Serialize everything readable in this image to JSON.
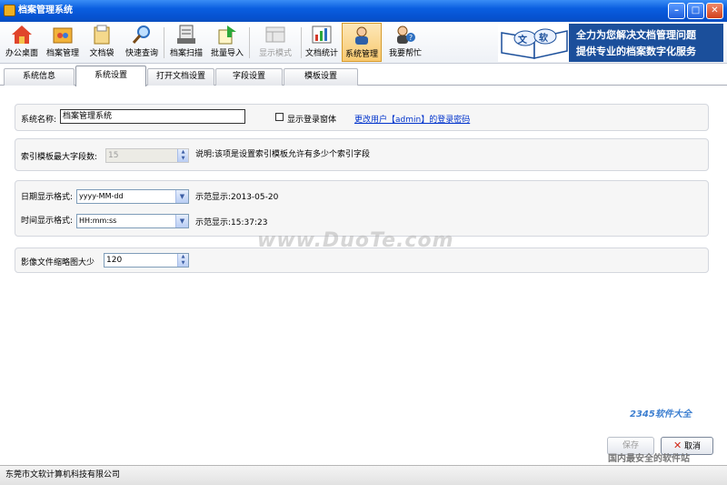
{
  "window": {
    "title": "档案管理系统",
    "minimize_icon": "minimize-icon",
    "maximize_icon": "maximize-icon",
    "close_icon": "close-icon"
  },
  "toolbar": {
    "items": [
      {
        "label": "办公桌面",
        "icon": "home-icon"
      },
      {
        "label": "档案管理",
        "icon": "folder-icon"
      },
      {
        "label": "文档袋",
        "icon": "envelope-icon"
      },
      {
        "label": "快速查询",
        "icon": "magnifier-icon"
      },
      {
        "label": "档案扫描",
        "icon": "scanner-icon"
      },
      {
        "label": "批量导入",
        "icon": "import-icon"
      },
      {
        "label": "显示模式",
        "icon": "view-mode-icon"
      },
      {
        "label": "文档统计",
        "icon": "chart-icon"
      },
      {
        "label": "系统管理",
        "icon": "admin-icon"
      },
      {
        "label": "我要帮忙",
        "icon": "help-icon"
      }
    ]
  },
  "banner": {
    "book_text_1": "文",
    "book_text_2": "软",
    "line1": "全力为您解决文档管理问题",
    "line2": "提供专业的档案数字化服务"
  },
  "tabs": [
    "系统信息",
    "系统设置",
    "打开文档设置",
    "字段设置",
    "模板设置"
  ],
  "active_tab": "系统设置",
  "settings": {
    "system_name_label": "系统名称:",
    "system_name_value": "档案管理系统",
    "show_login_label": "显示登录窗体",
    "change_password_link": "更改用户【admin】的登录密码",
    "index_max_label": "索引模板最大字段数:",
    "index_max_value": "15",
    "index_note": "说明:该项是设置索引模板允许有多少个索引字段",
    "date_format_label": "日期显示格式:",
    "date_format_value": "yyyy-MM-dd",
    "date_example": "示范显示:2013-05-20",
    "time_format_label": "时间显示格式:",
    "time_format_value": "HH:mm:ss",
    "time_example": "示范显示:15:37:23",
    "thumb_size_label": "影像文件缩略图大少",
    "thumb_size_value": "120"
  },
  "watermarks": {
    "duote": "www.DuoTe.com",
    "site": "2345软件大全",
    "slogan": "国内最安全的软件站"
  },
  "buttons": {
    "save": "保存",
    "cancel": "取消"
  },
  "status": {
    "company": "东莞市文软计算机科技有限公司"
  }
}
